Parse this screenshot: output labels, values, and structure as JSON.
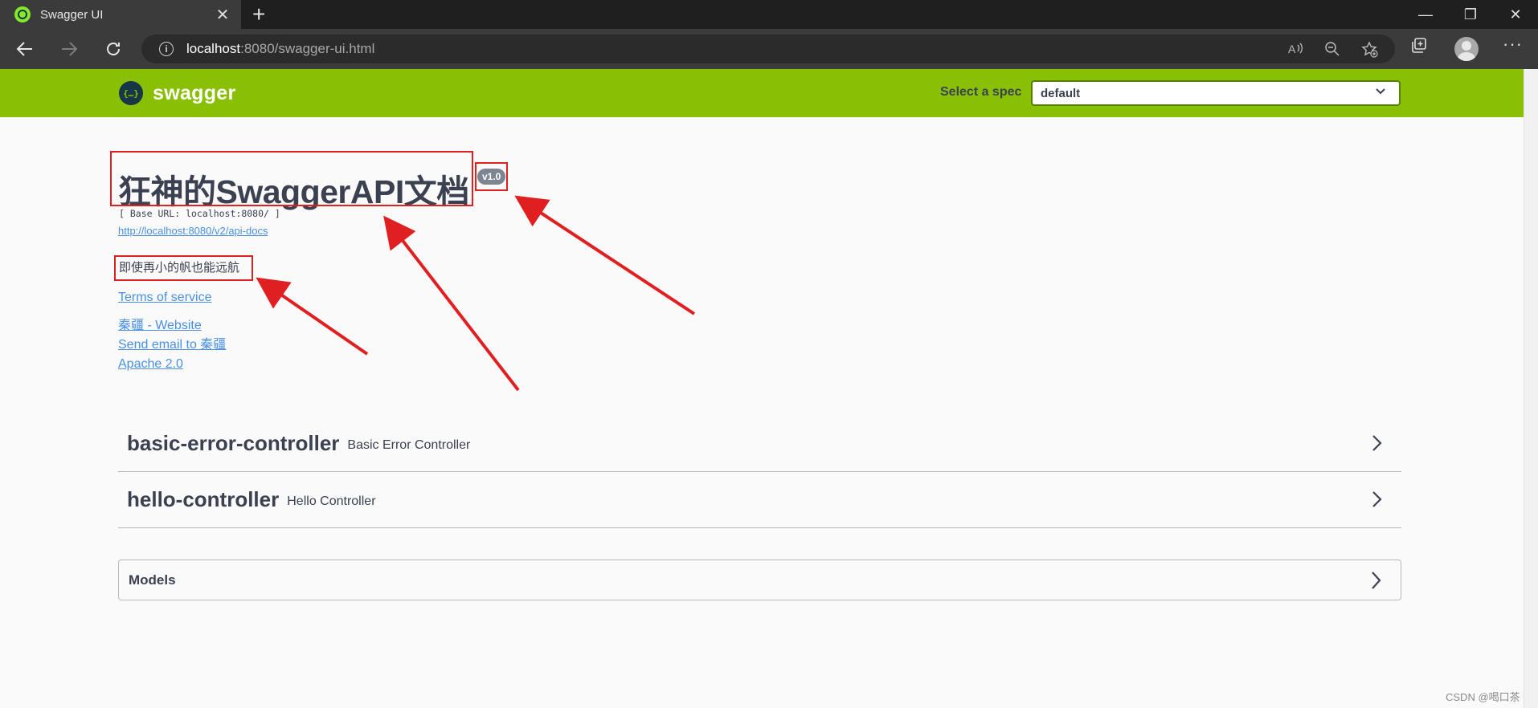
{
  "browser": {
    "tab_title": "Swagger UI",
    "tab_close": "✕",
    "new_tab": "+",
    "url_host": "localhost",
    "url_rest": ":8080/swagger-ui.html"
  },
  "window_controls": {
    "minimize": "—",
    "restore": "❐",
    "close": "✕"
  },
  "topbar": {
    "logo_mark": "{…}",
    "logo_text": "swagger",
    "spec_label": "Select a spec",
    "spec_value": "default"
  },
  "info": {
    "title": "狂神的SwaggerAPI文档",
    "version": "v1.0",
    "base_url": "[ Base URL: localhost:8080/ ]",
    "api_docs_link": "http://localhost:8080/v2/api-docs",
    "description": "即使再小的帆也能远航",
    "terms_link": "Terms of service",
    "website_link": "秦疆 - Website",
    "email_link": "Send email to 秦疆",
    "license_link": "Apache 2.0"
  },
  "tags": [
    {
      "name": "basic-error-controller",
      "description": "Basic Error Controller"
    },
    {
      "name": "hello-controller",
      "description": "Hello Controller"
    }
  ],
  "models": {
    "label": "Models"
  },
  "watermark": "CSDN @喝口茶",
  "colors": {
    "topbar": "#89bf04",
    "link": "#4990e2",
    "annotation": "#e02020"
  }
}
